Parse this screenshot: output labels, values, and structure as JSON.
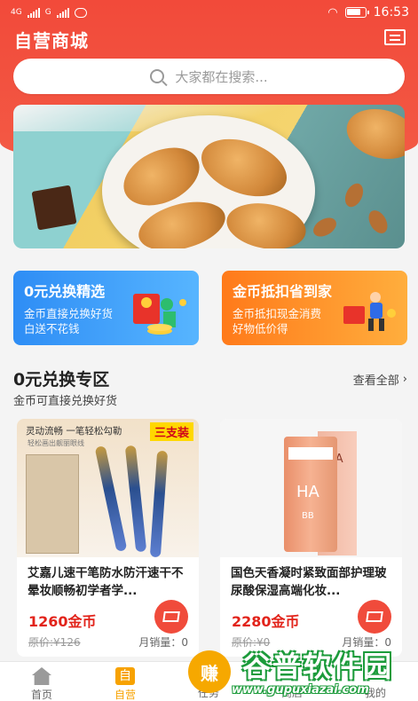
{
  "status_bar": {
    "network_left": "4G",
    "network_right": "G",
    "time": "16:53"
  },
  "header": {
    "title": "自营商城"
  },
  "search": {
    "placeholder": "大家都在搜索..."
  },
  "promos": [
    {
      "title": "0元兑换精选",
      "line1": "金币直接兑换好货",
      "line2": "白送不花钱"
    },
    {
      "title": "金币抵扣省到家",
      "line1": "金币抵扣现金消费",
      "line2": "好物低价得"
    }
  ],
  "section": {
    "title": "0元兑换专区",
    "subtitle": "金币可直接兑换好货",
    "see_all": "查看全部"
  },
  "products": [
    {
      "name": "艾嘉儿速干笔防水防汗速干不晕妆顺畅初学者学...",
      "price": "1260金币",
      "orig_price": "原价:¥126",
      "monthly_sales": "月销量：0",
      "img_line1": "灵动流畅 一笔轻松勾勒",
      "img_line2": "轻松画出靓丽眼线",
      "img_tag": "三支装"
    },
    {
      "name": "国色天香凝时紧致面部护理玻尿酸保湿高端化妆...",
      "price": "2280金币",
      "orig_price": "原价:¥0",
      "monthly_sales": "月销量：0",
      "img_brand": "HA",
      "img_bb": "BB"
    }
  ],
  "bottom_nav": [
    {
      "label": "首页"
    },
    {
      "label": "自营",
      "icon_text": "自"
    },
    {
      "label": "任务",
      "bubble": "赚"
    },
    {
      "label": "商店"
    },
    {
      "label": "我的"
    }
  ],
  "watermark": {
    "big": "谷普软件园",
    "small": "www.gupuxiazai.com"
  },
  "colors": {
    "brand_red": "#f24a3a",
    "price_red": "#e2231a",
    "nav_active": "#f7a200"
  }
}
